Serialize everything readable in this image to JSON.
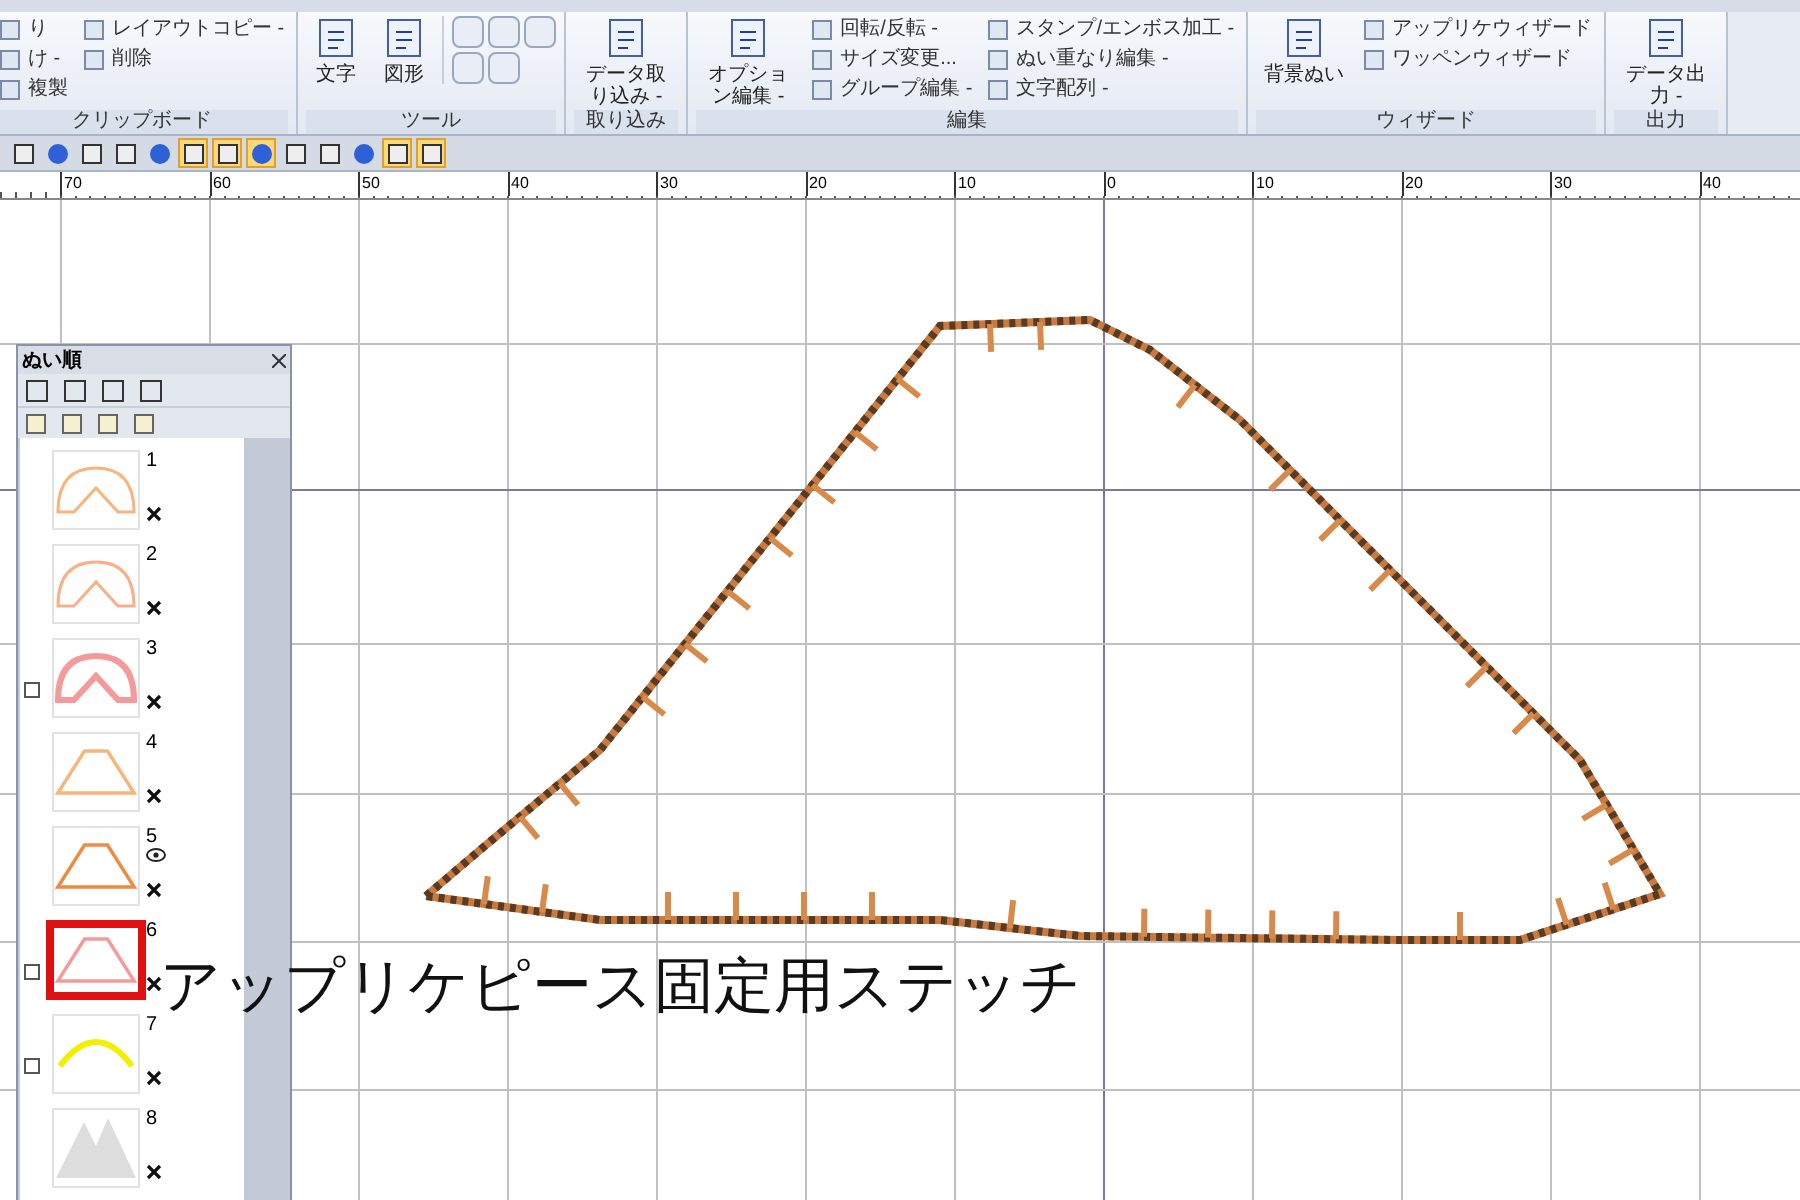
{
  "ribbon": {
    "groups": [
      {
        "label": "クリップボード",
        "items": [
          {
            "kind": "small",
            "label": "り"
          },
          {
            "kind": "small",
            "label": "け -"
          },
          {
            "kind": "small",
            "label": "複製"
          },
          {
            "kind": "small",
            "label": "レイアウトコピー -"
          },
          {
            "kind": "small",
            "label": "削除"
          }
        ]
      },
      {
        "label": "ツール",
        "items": [
          {
            "kind": "large",
            "label": "文字"
          },
          {
            "kind": "large",
            "label": "図形"
          },
          {
            "kind": "tools"
          }
        ]
      },
      {
        "label": "取り込み",
        "items": [
          {
            "kind": "large",
            "label": "データ取り込み -"
          }
        ]
      },
      {
        "label": "編集",
        "items": [
          {
            "kind": "large",
            "label": "オプション編集 -"
          },
          {
            "kind": "small",
            "label": "回転/反転 -"
          },
          {
            "kind": "small",
            "label": "サイズ変更..."
          },
          {
            "kind": "small",
            "label": "グループ編集 -"
          },
          {
            "kind": "small",
            "label": "スタンプ/エンボス加工 -"
          },
          {
            "kind": "small",
            "label": "ぬい重なり編集 -"
          },
          {
            "kind": "small",
            "label": "文字配列 -"
          }
        ]
      },
      {
        "label": "ウィザード",
        "items": [
          {
            "kind": "large",
            "label": "背景ぬい"
          },
          {
            "kind": "small",
            "label": "アップリケウィザード"
          },
          {
            "kind": "small",
            "label": "ワッペンウィザード"
          }
        ]
      },
      {
        "label": "出力",
        "items": [
          {
            "kind": "large",
            "label": "データ出力 -"
          }
        ]
      }
    ]
  },
  "toolbar": {
    "buttons": [
      {
        "selected": false
      },
      {
        "selected": false
      },
      {
        "selected": false
      },
      {
        "selected": false
      },
      {
        "selected": false
      },
      {
        "selected": true
      },
      {
        "selected": true
      },
      {
        "selected": true
      },
      {
        "selected": false
      },
      {
        "selected": false
      },
      {
        "selected": false
      },
      {
        "selected": true
      },
      {
        "selected": true
      }
    ]
  },
  "ruler": {
    "labels": [
      "70",
      "60",
      "50",
      "40",
      "30",
      "20",
      "10",
      "0",
      "10",
      "20",
      "30",
      "40"
    ]
  },
  "panel": {
    "title": "ぬい順",
    "items": [
      {
        "number": "1",
        "kind": "arch",
        "color": "#f8b47a",
        "expandable": false,
        "eye": false,
        "selected": false
      },
      {
        "number": "2",
        "kind": "arch",
        "color": "#f8b08a",
        "expandable": false,
        "eye": false,
        "selected": false
      },
      {
        "number": "3",
        "kind": "arch-thick",
        "color": "#f59a9a",
        "expandable": true,
        "eye": false,
        "selected": false
      },
      {
        "number": "4",
        "kind": "trapezoid",
        "color": "#f8b47a",
        "expandable": false,
        "eye": false,
        "selected": false
      },
      {
        "number": "5",
        "kind": "trapezoid",
        "color": "#f08a40",
        "expandable": false,
        "eye": true,
        "selected": false
      },
      {
        "number": "6",
        "kind": "trapezoid",
        "color": "#f59a9a",
        "expandable": true,
        "eye": false,
        "selected": true
      },
      {
        "number": "7",
        "kind": "curve",
        "color": "#f0f000",
        "expandable": true,
        "eye": false,
        "selected": false
      },
      {
        "number": "8",
        "kind": "mountain",
        "color": "#dddddd",
        "expandable": false,
        "eye": false,
        "selected": false
      }
    ]
  },
  "callout": {
    "text": "アップリケピース固定用ステッチ"
  }
}
